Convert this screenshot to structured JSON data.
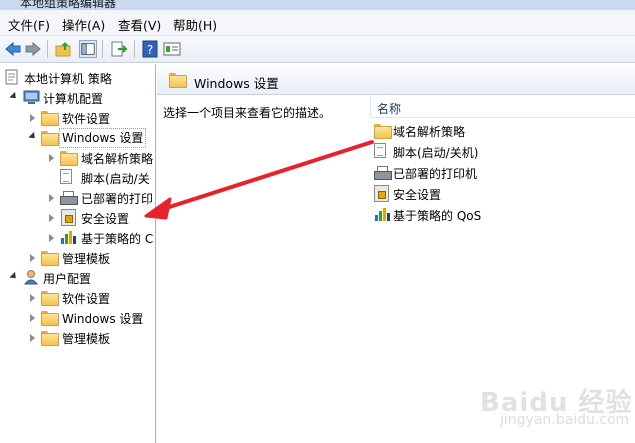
{
  "window": {
    "title": "本地组策略编辑器"
  },
  "menu": [
    "文件(F)",
    "操作(A)",
    "查看(V)",
    "帮助(H)"
  ],
  "tree": {
    "root": "本地计算机 策略",
    "computer_config": "计算机配置",
    "software_settings": "软件设置",
    "windows_settings": "Windows 设置",
    "dns_policy": "域名解析策略",
    "scripts": "脚本(启动/关",
    "printers": "已部署的打印",
    "security_settings": "安全设置",
    "qos": "基于策略的 C",
    "admin_templates": "管理模板",
    "user_config": "用户配置",
    "user_software_settings": "软件设置",
    "user_windows_settings": "Windows 设置",
    "user_admin_templates": "管理模板"
  },
  "right": {
    "header": "Windows 设置",
    "description": "选择一个项目来查看它的描述。",
    "column_name": "名称",
    "items": [
      "域名解析策略",
      "脚本(启动/关机)",
      "已部署的打印机",
      "安全设置",
      "基于策略的 QoS"
    ]
  },
  "watermark": {
    "main": "Baidu 经验",
    "sub": "jingyan.baidu.com"
  },
  "colors": {
    "arrow": "#e8222a",
    "folder": "#f2c24e",
    "selection_border": "#7da2ce"
  }
}
